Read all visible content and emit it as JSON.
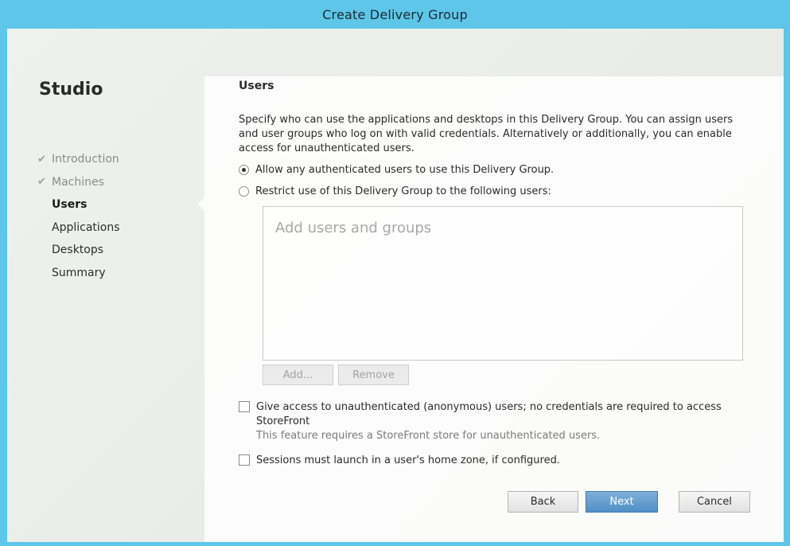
{
  "window": {
    "title": "Create Delivery Group"
  },
  "sidebar": {
    "brand": "Studio",
    "steps": [
      {
        "label": "Introduction",
        "state": "completed",
        "check": "✔"
      },
      {
        "label": "Machines",
        "state": "completed",
        "check": "✔"
      },
      {
        "label": "Users",
        "state": "current"
      },
      {
        "label": "Applications",
        "state": "pending"
      },
      {
        "label": "Desktops",
        "state": "pending"
      },
      {
        "label": "Summary",
        "state": "pending"
      }
    ]
  },
  "main": {
    "title": "Users",
    "description": "Specify who can use the applications and desktops in this Delivery Group. You can assign users and user groups who log on with valid credentials. Alternatively or additionally, you can enable access for unauthenticated users.",
    "options": {
      "allow_authenticated": {
        "label": "Allow any authenticated users to use this Delivery Group.",
        "selected": true
      },
      "restrict": {
        "label": "Restrict use of this Delivery Group to the following users:",
        "selected": false
      }
    },
    "users_box": {
      "placeholder": "Add users and groups"
    },
    "add_button": "Add...",
    "remove_button": "Remove",
    "anonymous": {
      "label": "Give access to unauthenticated (anonymous) users; no credentials are required to access StoreFront",
      "note": "This feature requires a StoreFront store for unauthenticated users.",
      "checked": false
    },
    "home_zone": {
      "label": "Sessions must launch in a user's home zone, if configured.",
      "checked": false
    }
  },
  "footer": {
    "back": "Back",
    "next": "Next",
    "cancel": "Cancel"
  },
  "colors": {
    "title_bar": "#5ec6e8",
    "primary_button": "#4f8fc6"
  }
}
